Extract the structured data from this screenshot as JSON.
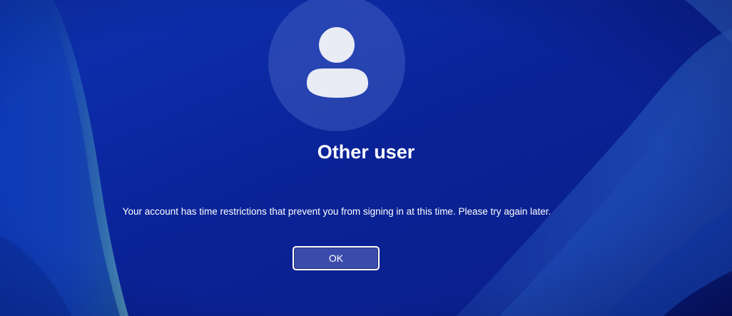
{
  "lock_screen": {
    "account_name": "Other user",
    "message": "Your account has time restrictions that prevent you from signing in at this time. Please try again later.",
    "ok_button_label": "OK",
    "avatar_icon": "person-icon"
  },
  "colors": {
    "background": "#0b2aa6",
    "button_fill": "#3a4bab",
    "text": "#ffffff"
  }
}
